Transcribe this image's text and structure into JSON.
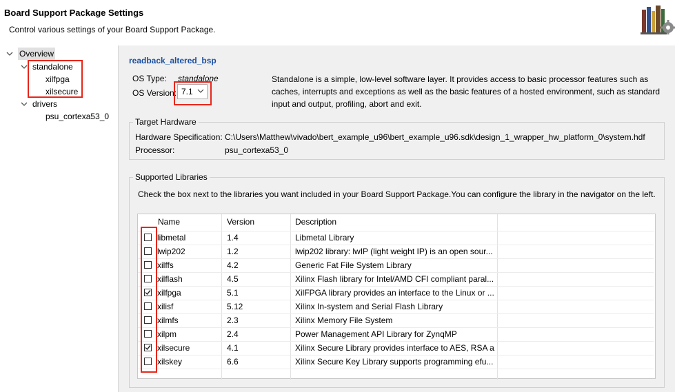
{
  "header": {
    "title": "Board Support Package Settings",
    "subtitle": "Control various settings of your Board Support Package."
  },
  "tree": {
    "overview": "Overview",
    "standalone": "standalone",
    "xilfpga": "xilfpga",
    "xilsecure": "xilsecure",
    "drivers": "drivers",
    "psu": "psu_cortexa53_0"
  },
  "main": {
    "bsp_name": "readback_altered_bsp",
    "os_type_label": "OS Type:",
    "os_type_value": "standalone",
    "os_version_label": "OS Version:",
    "os_version_value": "7.1",
    "description_lines": [
      "Standalone is a simple, low-level software layer. It provides access to basic processor features such as",
      "caches, interrupts and exceptions as well as the basic features of a hosted environment, such as standard",
      "input and output, profiling, abort and exit."
    ]
  },
  "target": {
    "title": "Target Hardware",
    "hw_label": "Hardware Specification:",
    "hw_value": "C:\\Users\\Matthew\\vivado\\bert_example_u96\\bert_example_u96.sdk\\design_1_wrapper_hw_platform_0\\system.hdf",
    "proc_label": "Processor:",
    "proc_value": "psu_cortexa53_0"
  },
  "libs": {
    "title": "Supported Libraries",
    "instructions": "Check the box next to the libraries you want included in your Board Support Package.You can configure the library in the navigator on the left.",
    "columns": {
      "name": "Name",
      "version": "Version",
      "description": "Description"
    },
    "rows": [
      {
        "name": "libmetal",
        "version": "1.4",
        "description": "Libmetal Library",
        "checked": false
      },
      {
        "name": "lwip202",
        "version": "1.2",
        "description": "lwip202 library: lwIP (light weight IP) is an open sour...",
        "checked": false
      },
      {
        "name": "xilffs",
        "version": "4.2",
        "description": "Generic Fat File System Library",
        "checked": false
      },
      {
        "name": "xilflash",
        "version": "4.5",
        "description": "Xilinx Flash library for Intel/AMD CFI compliant paral...",
        "checked": false
      },
      {
        "name": "xilfpga",
        "version": "5.1",
        "description": "XilFPGA library provides an interface to the Linux or ...",
        "checked": true
      },
      {
        "name": "xilisf",
        "version": "5.12",
        "description": "Xilinx In-system and Serial Flash Library",
        "checked": false
      },
      {
        "name": "xilmfs",
        "version": "2.3",
        "description": "Xilinx Memory File System",
        "checked": false
      },
      {
        "name": "xilpm",
        "version": "2.4",
        "description": "Power Management API Library for ZynqMP",
        "checked": false
      },
      {
        "name": "xilsecure",
        "version": "4.1",
        "description": "Xilinx Secure Library provides interface to AES, RSA a...",
        "checked": true
      },
      {
        "name": "xilskey",
        "version": "6.6",
        "description": "Xilinx Secure Key Library supports programming efu...",
        "checked": false
      }
    ]
  },
  "colors": {
    "link": "#1a4fa0",
    "highlight": "#e8261a"
  },
  "icons": {
    "header": "library-books-gear-icon"
  }
}
